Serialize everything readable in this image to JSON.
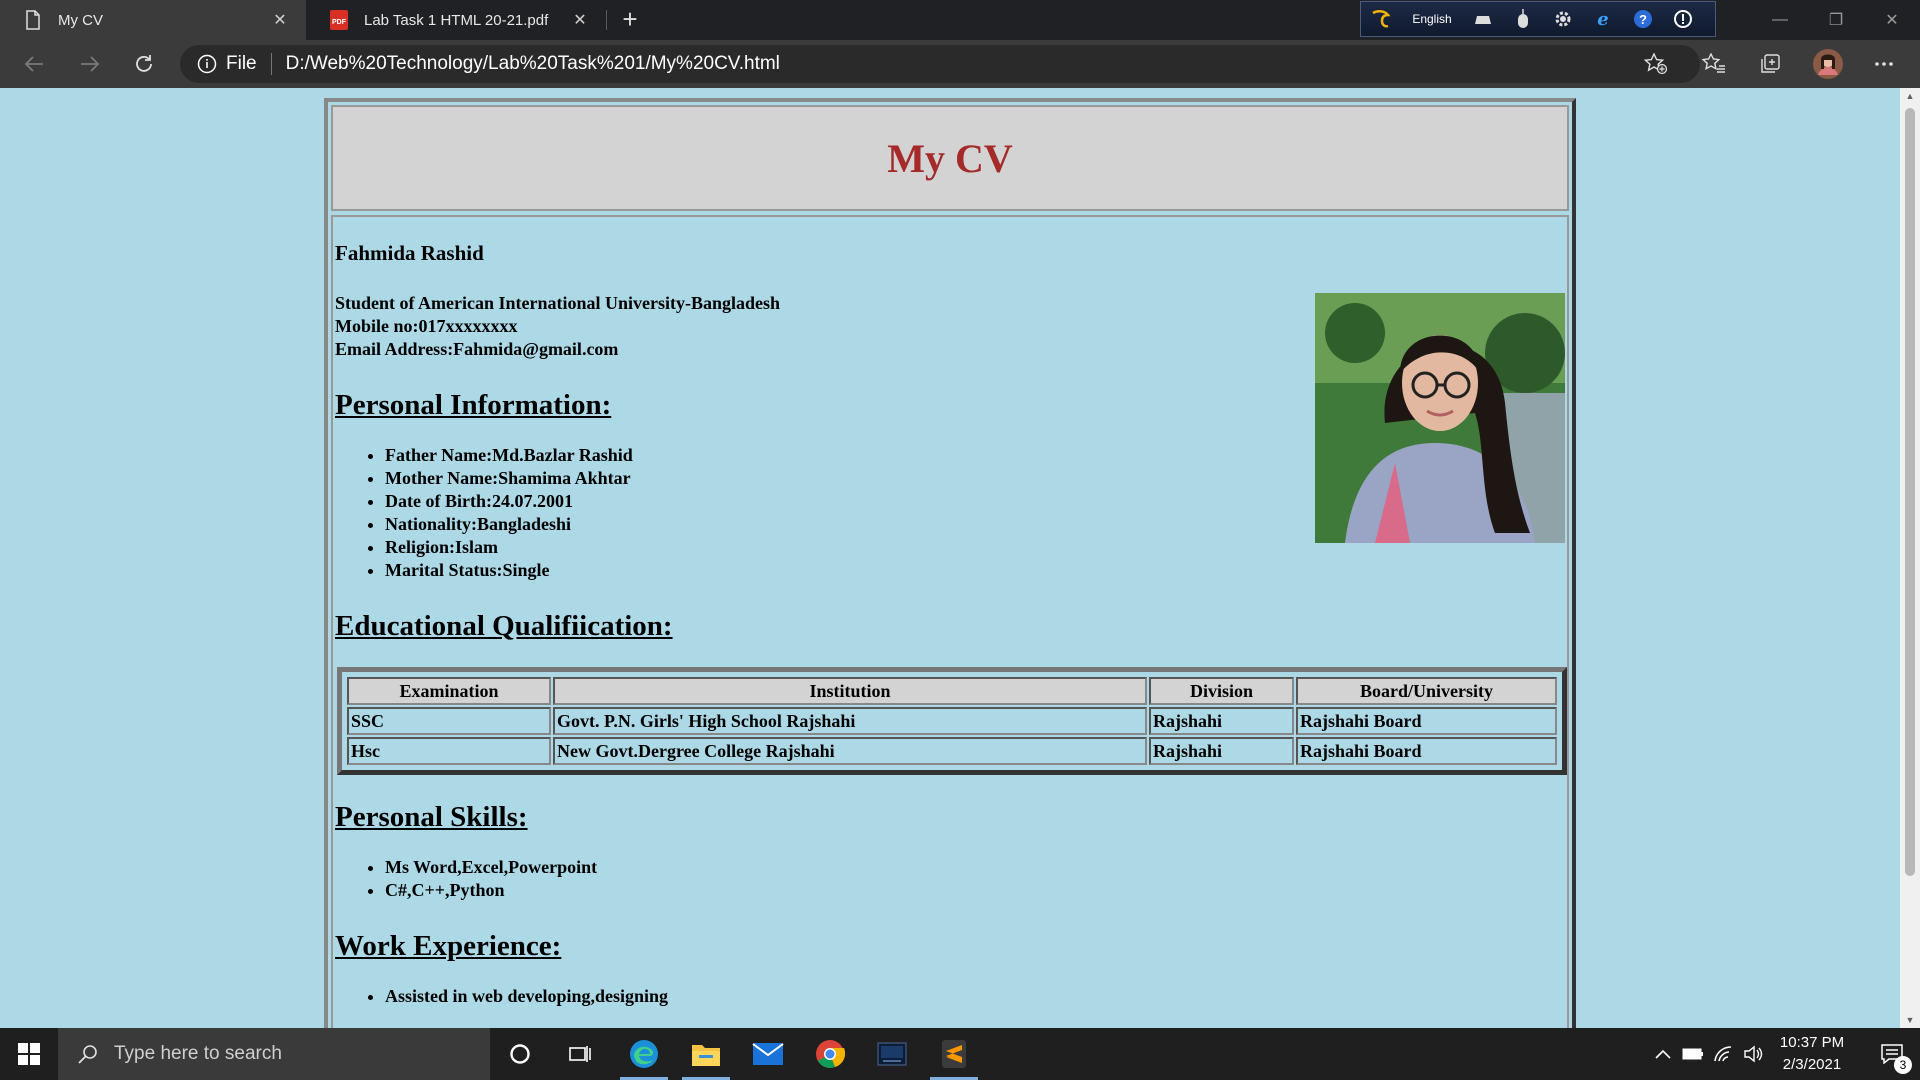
{
  "browser": {
    "tabs": [
      {
        "title": "My CV",
        "active": true,
        "icon": "document-icon"
      },
      {
        "title": "Lab Task 1 HTML 20-21.pdf",
        "active": false,
        "icon": "pdf-icon"
      }
    ],
    "address": {
      "scheme_label": "File",
      "url": "D:/Web%20Technology/Lab%20Task%201/My%20CV.html"
    },
    "language_bar": {
      "language": "English"
    }
  },
  "page": {
    "header_title": "My CV",
    "name": "Fahmida Rashid",
    "contact": [
      "Student of American International University-Bangladesh",
      "Mobile no:017xxxxxxxx",
      "Email Address:Fahmida@gmail.com"
    ],
    "sections": {
      "personal_info": {
        "heading": "Personal Information:",
        "items": [
          "Father Name:Md.Bazlar Rashid",
          "Mother Name:Shamima Akhtar",
          "Date of Birth:24.07.2001",
          "Nationality:Bangladeshi",
          "Religion:Islam",
          "Marital Status:Single"
        ]
      },
      "education": {
        "heading": "Educational Qualifiication:",
        "columns": [
          "Examination",
          "Institution",
          "Division",
          "Board/University"
        ],
        "rows": [
          [
            "SSC",
            "Govt. P.N. Girls' High School Rajshahi",
            "Rajshahi",
            "Rajshahi Board"
          ],
          [
            "Hsc",
            "New Govt.Dergree College Rajshahi",
            "Rajshahi",
            "Rajshahi Board"
          ]
        ]
      },
      "skills": {
        "heading": "Personal Skills:",
        "items": [
          "Ms Word,Excel,Powerpoint",
          "C#,C++,Python"
        ]
      },
      "work": {
        "heading": "Work Experience:",
        "items": [
          "Assisted in web developing,designing"
        ]
      }
    },
    "colors": {
      "background": "#add8e6",
      "header_bg": "#d3d3d3",
      "title": "#a52a2a"
    }
  },
  "taskbar": {
    "search_placeholder": "Type here to search",
    "time": "10:37 PM",
    "date": "2/3/2021",
    "notification_count": "3"
  }
}
